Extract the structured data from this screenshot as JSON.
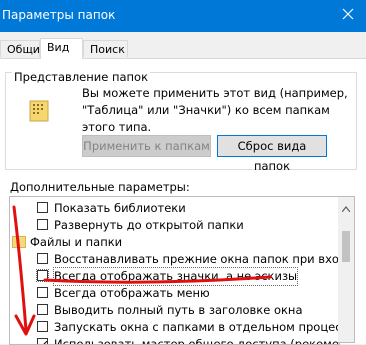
{
  "window": {
    "title": "Параметры папок"
  },
  "tabs": [
    "Общие",
    "Вид",
    "Поиск"
  ],
  "folder_views": {
    "label": "Представление папок",
    "description": "Вы можете применить этот вид (например, \"Таблица\" или \"Значки\") ко всем папкам этого типа.",
    "apply_button": "Применить к папкам",
    "reset_button": "Сброс вида папок"
  },
  "advanced": {
    "label": "Дополнительные параметры:",
    "items": [
      {
        "label": "Показать библиотеки",
        "checked": false
      },
      {
        "label": "Развернуть до открытой папки",
        "checked": false
      },
      {
        "label": "Файлы и папки",
        "folder": true
      },
      {
        "label": "Восстанавливать прежние окна папок при входе в си",
        "checked": false
      },
      {
        "label": "Всегда отображать значки, а не эскизы",
        "checked": false
      },
      {
        "label": "Всегда отображать меню",
        "checked": false
      },
      {
        "label": "Выводить полный путь в заголовке окна",
        "checked": false
      },
      {
        "label": "Запускать окна с папками в отдельном процессе",
        "checked": false
      },
      {
        "label": "Использовать мастер общего доступа (рекомендует",
        "checked": true
      }
    ]
  },
  "colors": {
    "titlebar": "#0078d7",
    "annotation": "#e01010"
  }
}
